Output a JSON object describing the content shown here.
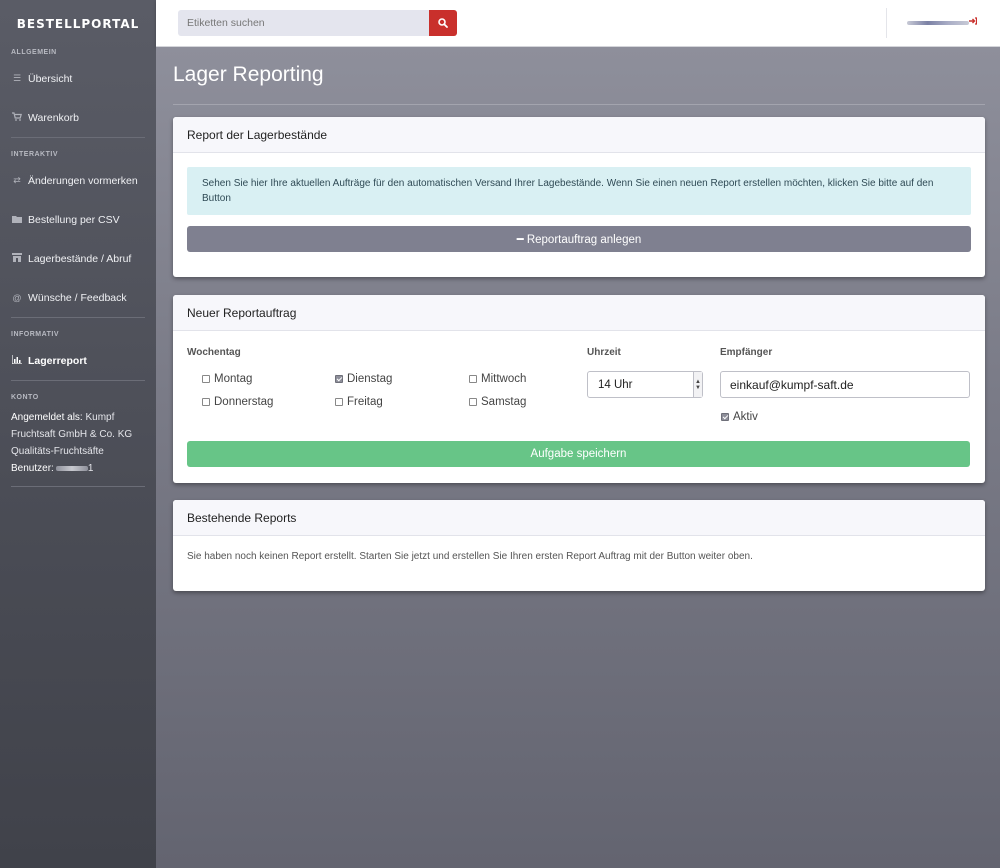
{
  "brand": "BESTELLPORTAL",
  "sidebar": {
    "sections": {
      "allgemein": "ALLGEMEIN",
      "interaktiv": "INTERAKTIV",
      "informativ": "INFORMATIV",
      "konto": "KONTO"
    },
    "items": {
      "uebersicht": "Übersicht",
      "warenkorb": "Warenkorb",
      "aenderungen": "Änderungen vormerken",
      "csv": "Bestellung per CSV",
      "lager": "Lagerbestände / Abruf",
      "feedback": "Wünsche / Feedback",
      "lagerreport": "Lagerreport"
    },
    "account": {
      "logged_in_label": "Angemeldet als:",
      "company_line1": "Kumpf",
      "company_line2": "Fruchtsaft GmbH & Co. KG",
      "company_line3": "Qualitäts-Fruchtsäfte",
      "user_label": "Benutzer:",
      "user_suffix": "1"
    }
  },
  "search": {
    "placeholder": "Etiketten suchen"
  },
  "page": {
    "title": "Lager Reporting"
  },
  "card_report": {
    "title": "Report der Lagerbestände",
    "info": "Sehen Sie hier Ihre aktuellen Aufträge für den automatischen Versand Ihrer Lagebestände. Wenn Sie einen neuen Report erstellen möchten, klicken Sie bitte auf den Button",
    "button": "━ Reportauftrag anlegen"
  },
  "card_new": {
    "title": "Neuer Reportauftrag",
    "weekday_label": "Wochentag",
    "days": {
      "montag": {
        "label": "Montag",
        "checked": false
      },
      "dienstag": {
        "label": "Dienstag",
        "checked": true
      },
      "mittwoch": {
        "label": "Mittwoch",
        "checked": false
      },
      "donnerstag": {
        "label": "Donnerstag",
        "checked": false
      },
      "freitag": {
        "label": "Freitag",
        "checked": false
      },
      "samstag": {
        "label": "Samstag",
        "checked": false
      }
    },
    "time_label": "Uhrzeit",
    "time_value": "14 Uhr",
    "recipient_label": "Empfänger",
    "recipient_value": "einkauf@kumpf-saft.de",
    "active_label": "Aktiv",
    "active_checked": true,
    "save_button": "Aufgabe speichern"
  },
  "card_existing": {
    "title": "Bestehende Reports",
    "empty_text": "Sie haben noch keinen Report erstellt. Starten Sie jetzt und erstellen Sie Ihren ersten Report Auftrag mit der Button weiter oben."
  },
  "colors": {
    "accent_red": "#c9302c",
    "save_green": "#67c587",
    "info_bg": "#d9f0f3",
    "sidebar_bg": "#4a4c55"
  }
}
